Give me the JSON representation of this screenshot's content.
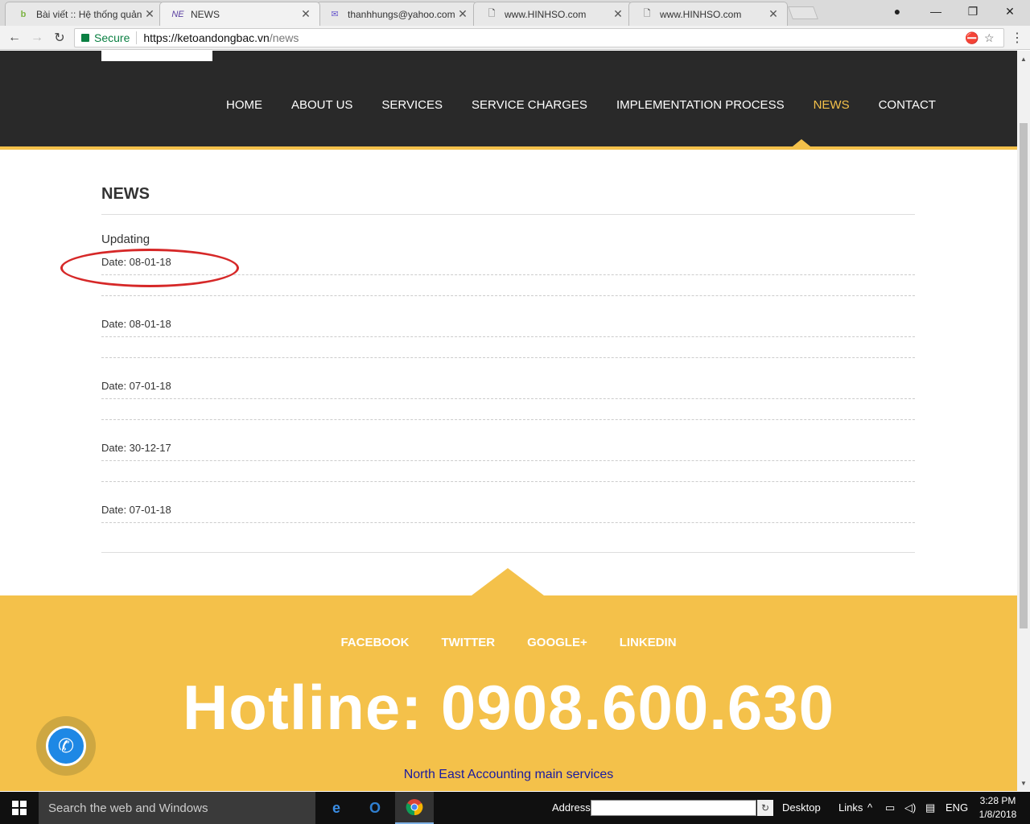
{
  "browser": {
    "tabs": [
      {
        "title": "Bài viết :: Hệ thống quản",
        "favicon": "b-icon",
        "active": false
      },
      {
        "title": "NEWS",
        "favicon": "ne-icon",
        "active": true
      },
      {
        "title": "thanhhungs@yahoo.com",
        "favicon": "mail-icon",
        "active": false
      },
      {
        "title": "www.HINHSO.com",
        "favicon": "page-icon",
        "active": false
      },
      {
        "title": "www.HINHSO.com",
        "favicon": "page-icon",
        "active": false
      }
    ],
    "secure_label": "Secure",
    "url_host": "https://ketoandongbac.vn",
    "url_path": "/news"
  },
  "site": {
    "menu": [
      {
        "label": "HOME",
        "active": false
      },
      {
        "label": "ABOUT US",
        "active": false
      },
      {
        "label": "SERVICES",
        "active": false
      },
      {
        "label": "SERVICE CHARGES",
        "active": false
      },
      {
        "label": "IMPLEMENTATION PROCESS",
        "active": false
      },
      {
        "label": "NEWS",
        "active": true
      },
      {
        "label": "CONTACT",
        "active": false
      }
    ],
    "page_title": "NEWS",
    "news": [
      {
        "title": "Updating",
        "date": "Date: 08-01-18"
      },
      {
        "title": "",
        "date": "Date: 08-01-18"
      },
      {
        "title": "",
        "date": "Date: 07-01-18"
      },
      {
        "title": "",
        "date": "Date: 30-12-17"
      },
      {
        "title": "",
        "date": "Date: 07-01-18"
      }
    ],
    "social": [
      "FACEBOOK",
      "TWITTER",
      "GOOGLE+",
      "LINKEDIN"
    ],
    "hotline": "Hotline: 0908.600.630",
    "services_link": "North East Accounting main services"
  },
  "taskbar": {
    "search_placeholder": "Search the web and Windows",
    "address_label": "Address",
    "desktop_label": "Desktop",
    "links_label": "Links",
    "language": "ENG",
    "time": "3:28 PM",
    "date": "1/8/2018"
  },
  "colors": {
    "accent": "#f4c14a",
    "header_bg": "#292929",
    "annotation": "#d62828"
  }
}
